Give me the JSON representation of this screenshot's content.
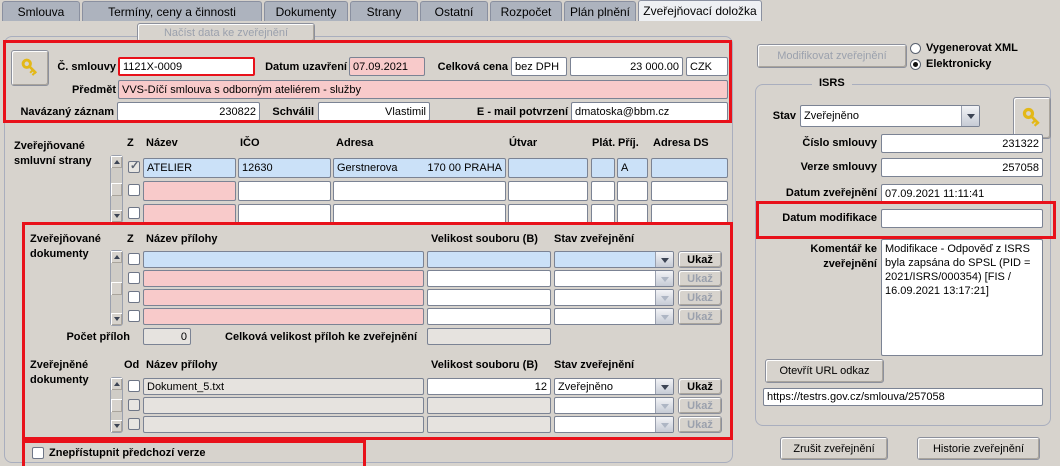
{
  "tabs": [
    {
      "label": "Smlouva",
      "active": false
    },
    {
      "label": "Termíny, ceny a činnosti",
      "active": false
    },
    {
      "label": "Dokumenty",
      "active": false
    },
    {
      "label": "Strany",
      "active": false
    },
    {
      "label": "Ostatní",
      "active": false
    },
    {
      "label": "Rozpočet",
      "active": false
    },
    {
      "label": "Plán plnění",
      "active": false
    },
    {
      "label": "Zveřejňovací doložka",
      "active": true
    }
  ],
  "load_button": "Načíst data ke zveřejnění",
  "form": {
    "cislo_smlouvy_label": "Č. smlouvy",
    "cislo_smlouvy": "1121X-0009",
    "datum_uzavreni_label": "Datum uzavření",
    "datum_uzavreni": "07.09.2021",
    "celkova_cena_label": "Celková cena",
    "dph_mode": "bez DPH",
    "celkova_cena": "23 000.00",
    "mena": "CZK",
    "predmet_label": "Předmět",
    "predmet": "VVS-Díčí smlouva s odborným ateliérem - služby",
    "navazany_zaznam_label": "Navázaný záznam",
    "navazany_zaznam": "230822",
    "schvalil_label": "Schválil",
    "schvalil": "Vlastimil",
    "email_label": "E - mail potvrzení",
    "email": "dmatoska@bbm.cz"
  },
  "parties": {
    "label_line1": "Zveřejňované",
    "label_line2": "smluvní strany",
    "headers": {
      "z": "Z",
      "nazev": "Název",
      "ico": "IČO",
      "adresa": "Adresa",
      "utvar": "Útvar",
      "plat": "Plát.",
      "prij": "Příj.",
      "adresa_ds": "Adresa DS"
    },
    "rows": [
      {
        "nazev": "ATELIER",
        "ico": "12630",
        "adresa_street": "Gerstnerova",
        "adresa_city": "170 00 PRAHA",
        "utvar": "",
        "plat": "",
        "prij": "A",
        "adresa_ds": ""
      },
      {
        "nazev": "",
        "ico": "",
        "adresa_street": "",
        "adresa_city": "",
        "utvar": "",
        "plat": "",
        "prij": "",
        "adresa_ds": ""
      },
      {
        "nazev": "",
        "ico": "",
        "adresa_street": "",
        "adresa_city": "",
        "utvar": "",
        "plat": "",
        "prij": "",
        "adresa_ds": ""
      }
    ]
  },
  "pub_docs": {
    "label_line1": "Zveřejňované",
    "label_line2": "dokumenty",
    "headers": {
      "z": "Z",
      "nazev": "Název přílohy",
      "velikost": "Velikost souboru (B)",
      "stav": "Stav zveřejnění"
    },
    "show_button": "Ukaž",
    "rows": [
      {
        "nazev": "",
        "velikost": "",
        "stav": ""
      },
      {
        "nazev": "",
        "velikost": "",
        "stav": ""
      },
      {
        "nazev": "",
        "velikost": "",
        "stav": ""
      },
      {
        "nazev": "",
        "velikost": "",
        "stav": ""
      }
    ],
    "pocet_priloh_label": "Počet příloh",
    "pocet_priloh": "0",
    "celkova_velikost_label": "Celková velikost příloh ke zveřejnění",
    "celkova_velikost": ""
  },
  "published_docs": {
    "label_line1": "Zveřejněné",
    "label_line2": "dokumenty",
    "headers": {
      "od": "Od",
      "nazev": "Název přílohy",
      "velikost": "Velikost souboru (B)",
      "stav": "Stav zveřejnění"
    },
    "show_button": "Ukaž",
    "rows": [
      {
        "nazev": "Dokument_5.txt",
        "velikost": "12",
        "stav": "Zveřejněno"
      },
      {
        "nazev": "",
        "velikost": "",
        "stav": ""
      },
      {
        "nazev": "",
        "velikost": "",
        "stav": ""
      }
    ]
  },
  "footer": {
    "hide_previous_label": "Znepřístupnit předchozí verze"
  },
  "right_panel": {
    "modify_button": "Modifikovat zveřejnění",
    "radio_xml": "Vygenerovat XML",
    "radio_electronic": "Elektronicky",
    "isrs": {
      "group_label": "ISRS",
      "stav_label": "Stav",
      "stav": "Zveřejněno",
      "cislo_smlouvy_label": "Číslo smlouvy",
      "cislo_smlouvy": "231322",
      "verze_smlouvy_label": "Verze smlouvy",
      "verze_smlouvy": "257058",
      "datum_zverejneni_label": "Datum zveřejnění",
      "datum_zverejneni": "07.09.2021 11:11:41",
      "datum_modifikace_label": "Datum modifikace",
      "datum_modifikace": "",
      "komentar_label_line1": "Komentář ke",
      "komentar_label_line2": "zveřejnění",
      "komentar": "Modifikace - Odpověď z ISRS byla zapsána do SPSL (PID = 2021/ISRS/000354) [FIS / 16.09.2021 13:17:21]",
      "open_url_button": "Otevřít URL odkaz",
      "url": "https://testrs.gov.cz/smlouva/257058"
    },
    "cancel_button": "Zrušit zveřejnění",
    "history_button": "Historie zveřejnění"
  },
  "icons": {
    "key": "key-icon",
    "dropdown_arrow": "chevron-down-icon",
    "scroll_up": "triangle-up-icon",
    "scroll_down": "triangle-down-icon"
  },
  "colors": {
    "annotation_red": "#e8111a",
    "required_pink": "#f8caca",
    "selected_blue": "#cbe1f8",
    "window_gray": "#d7d3cd"
  }
}
